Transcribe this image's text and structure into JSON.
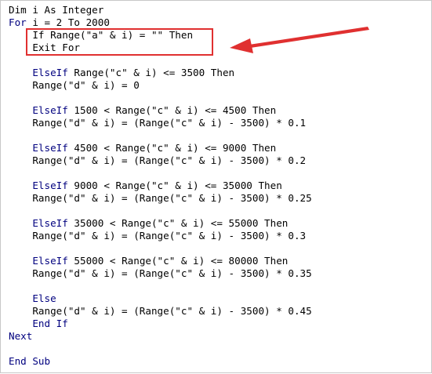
{
  "code_lines": [
    {
      "kw": "",
      "text": "Dim i As Integer"
    },
    {
      "kw": "For",
      "text": " i = 2 To 2000"
    },
    {
      "kw": "",
      "text": "    If Range(\"a\" & i) = \"\" Then"
    },
    {
      "kw": "",
      "text": "    Exit For"
    },
    {
      "kw": "",
      "text": ""
    },
    {
      "kw": "    ElseIf",
      "text": " Range(\"c\" & i) <= 3500 Then"
    },
    {
      "kw": "",
      "text": "    Range(\"d\" & i) = 0"
    },
    {
      "kw": "",
      "text": ""
    },
    {
      "kw": "    ElseIf",
      "text": " 1500 < Range(\"c\" & i) <= 4500 Then"
    },
    {
      "kw": "",
      "text": "    Range(\"d\" & i) = (Range(\"c\" & i) - 3500) * 0.1"
    },
    {
      "kw": "",
      "text": ""
    },
    {
      "kw": "    ElseIf",
      "text": " 4500 < Range(\"c\" & i) <= 9000 Then"
    },
    {
      "kw": "",
      "text": "    Range(\"d\" & i) = (Range(\"c\" & i) - 3500) * 0.2"
    },
    {
      "kw": "",
      "text": ""
    },
    {
      "kw": "    ElseIf",
      "text": " 9000 < Range(\"c\" & i) <= 35000 Then"
    },
    {
      "kw": "",
      "text": "    Range(\"d\" & i) = (Range(\"c\" & i) - 3500) * 0.25"
    },
    {
      "kw": "",
      "text": ""
    },
    {
      "kw": "    ElseIf",
      "text": " 35000 < Range(\"c\" & i) <= 55000 Then"
    },
    {
      "kw": "",
      "text": "    Range(\"d\" & i) = (Range(\"c\" & i) - 3500) * 0.3"
    },
    {
      "kw": "",
      "text": ""
    },
    {
      "kw": "    ElseIf",
      "text": " 55000 < Range(\"c\" & i) <= 80000 Then"
    },
    {
      "kw": "",
      "text": "    Range(\"d\" & i) = (Range(\"c\" & i) - 3500) * 0.35"
    },
    {
      "kw": "",
      "text": ""
    },
    {
      "kw": "    Else",
      "text": ""
    },
    {
      "kw": "",
      "text": "    Range(\"d\" & i) = (Range(\"c\" & i) - 3500) * 0.45"
    },
    {
      "kw": "    End If",
      "text": ""
    },
    {
      "kw": "Next",
      "text": ""
    },
    {
      "kw": "",
      "text": ""
    },
    {
      "kw": "End Sub",
      "text": ""
    }
  ],
  "colors": {
    "keyword": "#00007f",
    "text": "#000000",
    "highlight_box": "#e03030",
    "arrow": "#e03030"
  }
}
